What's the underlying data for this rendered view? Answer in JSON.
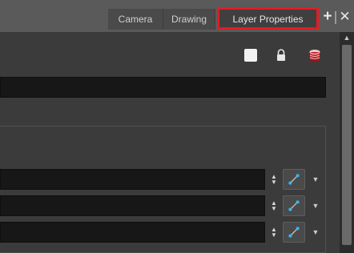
{
  "tabs": {
    "camera": "Camera",
    "drawing": "Drawing",
    "layer_properties": "Layer Properties"
  },
  "window_controls": {
    "add": "+",
    "close": "✕"
  },
  "layer": {
    "name_value": "",
    "fields": [
      {
        "value": ""
      },
      {
        "value": ""
      },
      {
        "value": ""
      }
    ]
  },
  "icons": {
    "color_swatch": "white-square-icon",
    "lock": "lock-icon",
    "layer_stack": "layer-stack-icon",
    "function": "function-curve-icon",
    "spinner": "up-down-arrows-icon",
    "dropdown": "triangle-down-icon"
  },
  "colors": {
    "highlight": "#e31b23",
    "background": "#3b3b3b",
    "field": "#171717",
    "function_dot": "#3ab4f2"
  }
}
